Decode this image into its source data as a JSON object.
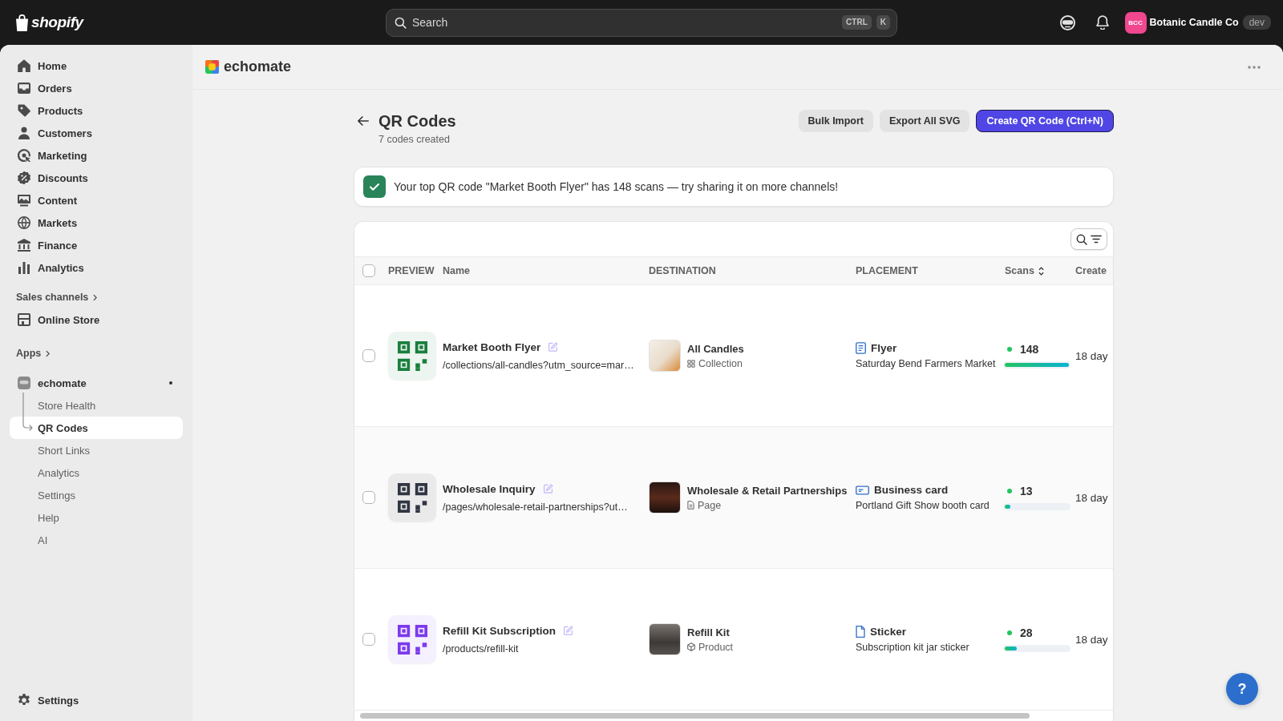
{
  "topbar": {
    "logo": "shopify",
    "search": {
      "placeholder": "Search",
      "shortcut": [
        "CTRL",
        "K"
      ]
    },
    "store": {
      "initials": "BCC",
      "name": "Botanic Candle Co",
      "badge": "dev"
    }
  },
  "sidebar": {
    "nav": [
      {
        "label": "Home",
        "selected": false
      },
      {
        "label": "Orders",
        "selected": false
      },
      {
        "label": "Products",
        "selected": false
      },
      {
        "label": "Customers",
        "selected": false
      },
      {
        "label": "Marketing",
        "selected": false
      },
      {
        "label": "Discounts",
        "selected": false
      },
      {
        "label": "Content",
        "selected": false
      },
      {
        "label": "Markets",
        "selected": false
      },
      {
        "label": "Finance",
        "selected": false
      },
      {
        "label": "Analytics",
        "selected": false
      }
    ],
    "sales_channels": {
      "heading": "Sales channels",
      "items": [
        {
          "label": "Online Store",
          "selected": false
        }
      ]
    },
    "apps": {
      "heading": "Apps",
      "items": [
        {
          "label": "echomate",
          "selected": false,
          "dot": true,
          "children": [
            {
              "label": "Store Health",
              "selected": false
            },
            {
              "label": "QR Codes",
              "selected": true
            },
            {
              "label": "Short Links",
              "selected": false
            },
            {
              "label": "Analytics",
              "selected": false
            },
            {
              "label": "Settings",
              "selected": false
            },
            {
              "label": "Help",
              "selected": false
            },
            {
              "label": "AI",
              "selected": false
            }
          ]
        }
      ]
    },
    "footer": {
      "label": "Settings",
      "selected": false
    }
  },
  "app_header": {
    "title": "echomate"
  },
  "page": {
    "title": "QR Codes",
    "subtitle": "7 codes created",
    "actions": [
      {
        "label": "Bulk Import",
        "kind": "secondary"
      },
      {
        "label": "Export All SVG",
        "kind": "secondary"
      },
      {
        "label": "Create QR Code (Ctrl+N)",
        "kind": "primary"
      }
    ]
  },
  "banner": {
    "text": "Your top QR code \"Market Booth Flyer\" has 148 scans — try sharing it on more channels!"
  },
  "table": {
    "select_all": false,
    "columns": [
      {
        "label": "PREVIEW",
        "sortable": false
      },
      {
        "label": "Name",
        "sortable": false
      },
      {
        "label": "DESTINATION",
        "sortable": false
      },
      {
        "label": "PLACEMENT",
        "sortable": false
      },
      {
        "label": "Scans",
        "sortable": true
      },
      {
        "label": "Create",
        "sortable": false
      }
    ],
    "rows": [
      {
        "checked": false,
        "color": "#1a7f3c",
        "name": "Market Booth Flyer",
        "url": "/collections/all-candles?utm_source=mar…",
        "destination": {
          "kind": "collection",
          "title": "All Candles",
          "type": "Collection"
        },
        "placement": {
          "kind": "flyer",
          "title": "Flyer",
          "note": "Saturday Bend Farmers Market"
        },
        "scans": "148",
        "level": 1,
        "created": "18 day"
      },
      {
        "checked": false,
        "color": "#303642",
        "name": "Wholesale Inquiry",
        "url": "/pages/wholesale-retail-partnerships?ut…",
        "destination": {
          "kind": "page",
          "title": "Wholesale & Retail Partnerships",
          "type": "Page"
        },
        "placement": {
          "kind": "business_card",
          "title": "Business card",
          "note": "Portland Gift Show booth card"
        },
        "scans": "13",
        "level": 0.09,
        "created": "18 day"
      },
      {
        "checked": false,
        "color": "#7c3aed",
        "name": "Refill Kit Subscription",
        "url": "/products/refill-kit",
        "destination": {
          "kind": "product",
          "title": "Refill Kit",
          "type": "Product"
        },
        "placement": {
          "kind": "sticker",
          "title": "Sticker",
          "note": "Subscription kit jar sticker"
        },
        "scans": "28",
        "level": 0.19,
        "created": "18 day"
      }
    ]
  },
  "help_button": "?"
}
